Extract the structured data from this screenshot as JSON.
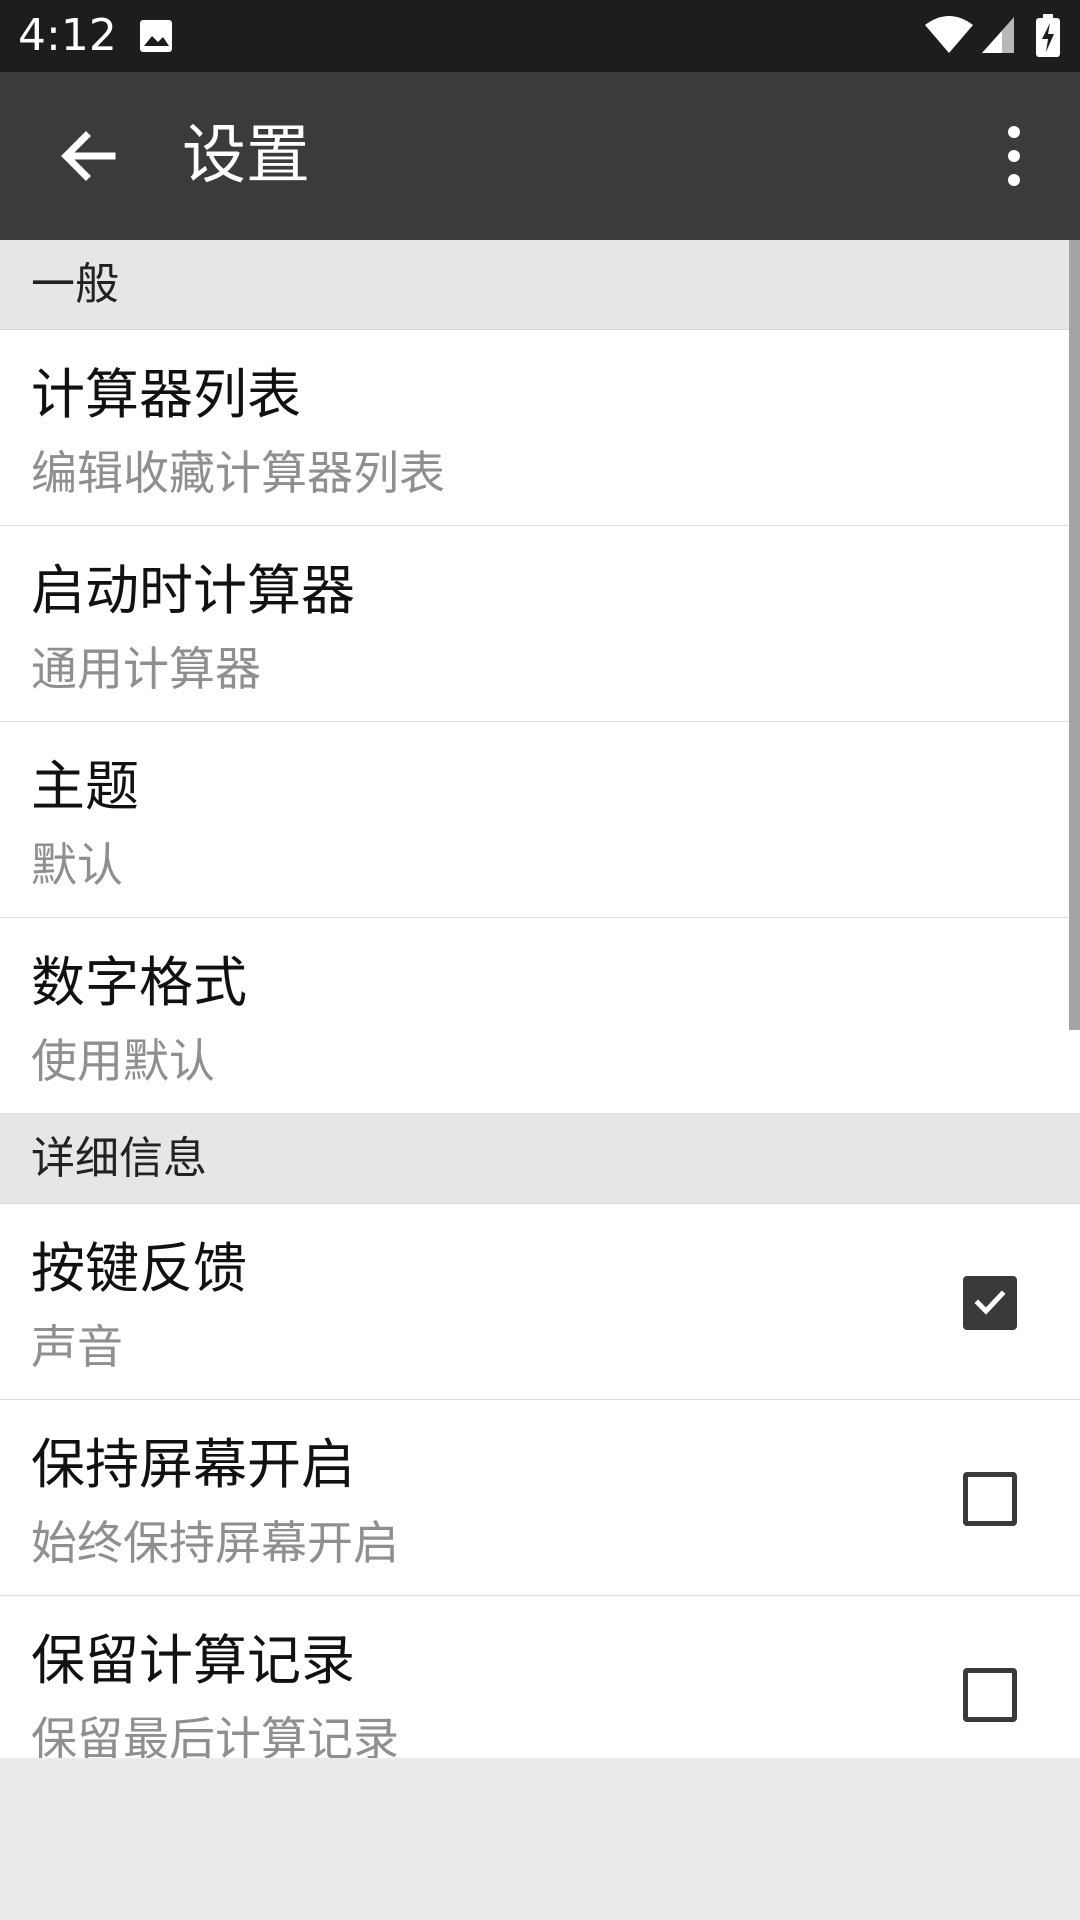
{
  "status_bar": {
    "time": "4:12",
    "icons": [
      "image-icon",
      "wifi-icon",
      "signal-icon",
      "battery-charging-icon"
    ]
  },
  "toolbar": {
    "title": "设置",
    "back_icon": "back-arrow-icon",
    "overflow_icon": "more-vert-icon"
  },
  "sections": [
    {
      "header": "一般",
      "items": [
        {
          "title": "计算器列表",
          "summary": "编辑收藏计算器列表"
        },
        {
          "title": "启动时计算器",
          "summary": "通用计算器"
        },
        {
          "title": "主题",
          "summary": "默认"
        },
        {
          "title": "数字格式",
          "summary": "使用默认"
        }
      ]
    },
    {
      "header": "详细信息",
      "items": [
        {
          "title": "按键反馈",
          "summary": "声音",
          "checked": true
        },
        {
          "title": "保持屏幕开启",
          "summary": "始终保持屏幕开启",
          "checked": false
        },
        {
          "title": "保留计算记录",
          "summary": "保留最后计算记录",
          "checked": false
        }
      ]
    }
  ],
  "colors": {
    "status_bar": "#1d1d1d",
    "toolbar": "#3b3b3b",
    "section_header": "#e6e6e6",
    "checkbox": "#3a3a3a",
    "summary_text": "#8f8f8f"
  }
}
